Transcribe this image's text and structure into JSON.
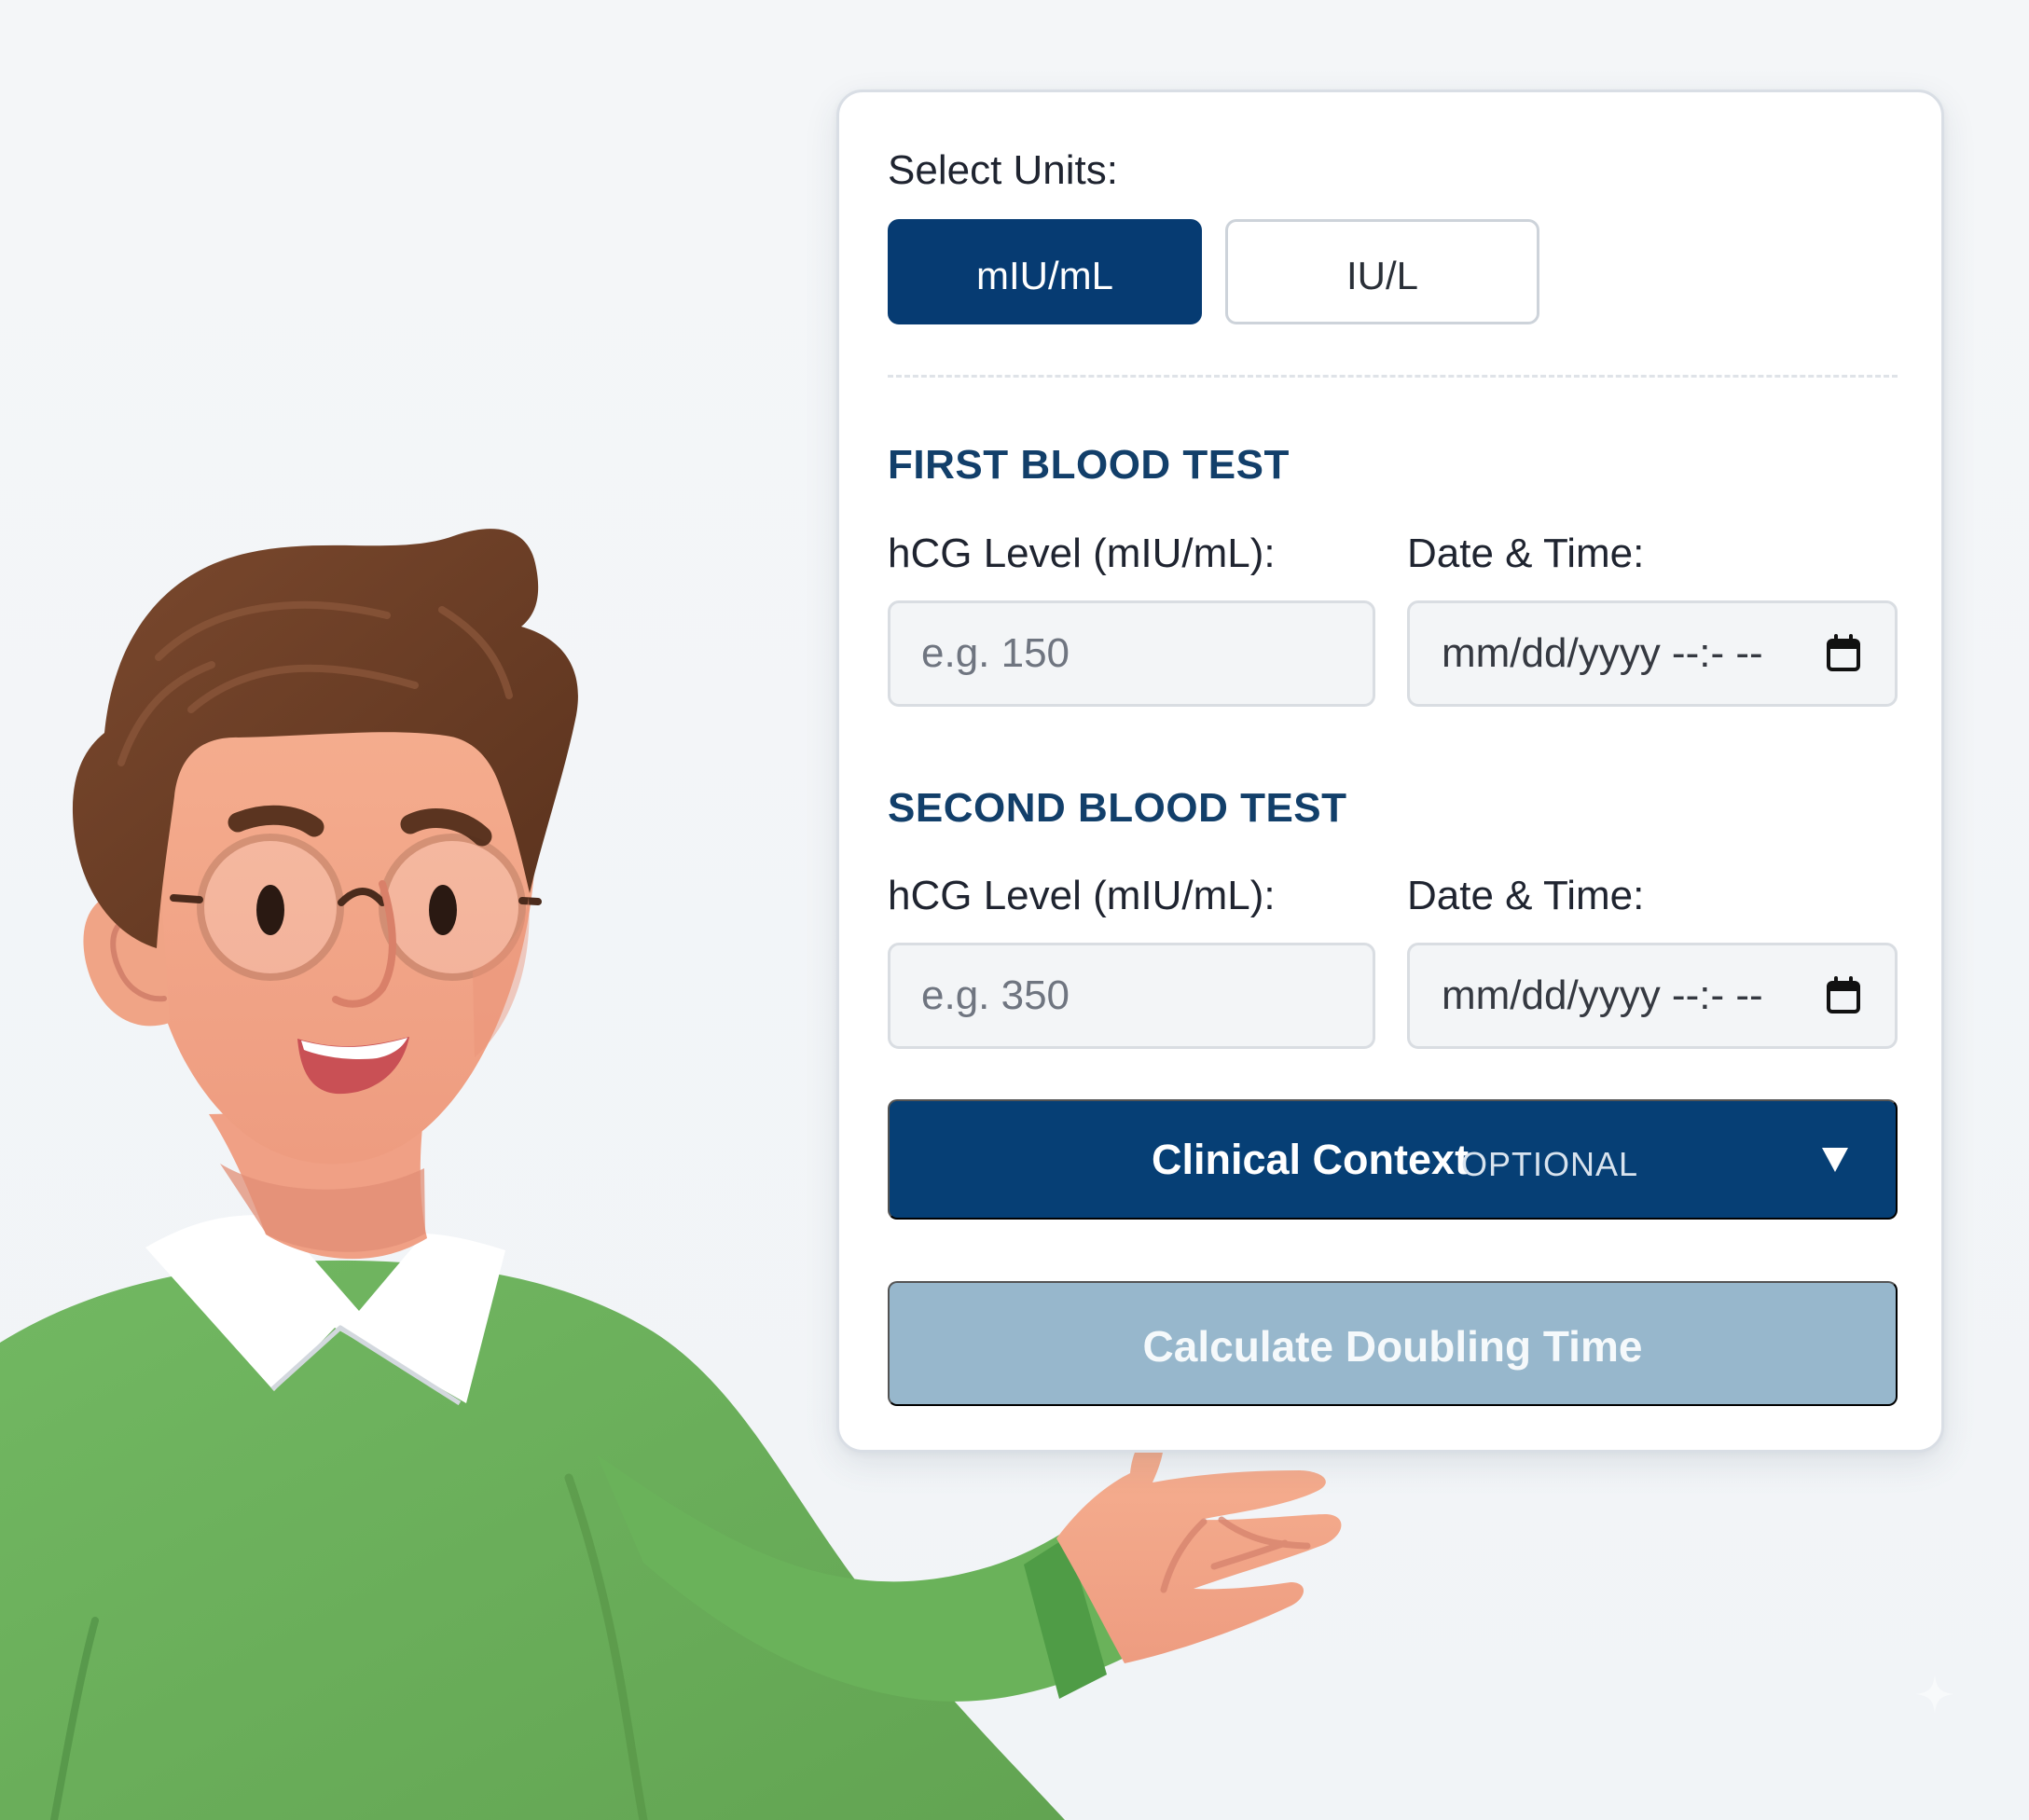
{
  "units": {
    "label": "Select Units:",
    "options": [
      {
        "label": "mIU/mL",
        "selected": true
      },
      {
        "label": "IU/L",
        "selected": false
      }
    ]
  },
  "first_test": {
    "title": "FIRST BLOOD TEST",
    "level_label": "hCG Level (mIU/mL):",
    "level_placeholder": "e.g. 150",
    "date_label": "Date & Time:",
    "date_value": "mm/dd/yyyy --:- --"
  },
  "second_test": {
    "title": "SECOND BLOOD TEST",
    "level_label": "hCG Level (mIU/mL):",
    "level_placeholder": "e.g. 350",
    "date_label": "Date & Time:",
    "date_value": "mm/dd/yyyy --:- --"
  },
  "clinical_context": {
    "title": "Clinical Context",
    "optional": "OPTIONAL",
    "icon": "chevron-down-icon"
  },
  "calculate_button": {
    "label": "Calculate Doubling Time"
  },
  "icons": {
    "date_picker": "calendar-icon",
    "illustration": "pointing-man-illustration",
    "corner_mark": "sparkle-icon"
  },
  "colors": {
    "primary_blue": "#063b72",
    "section_title": "#123f6a",
    "disabled_button": "#97b7cc",
    "sweater_green": "#6caf5b",
    "hair_brown": "#6b3e25",
    "skin": "#f2a58a"
  }
}
